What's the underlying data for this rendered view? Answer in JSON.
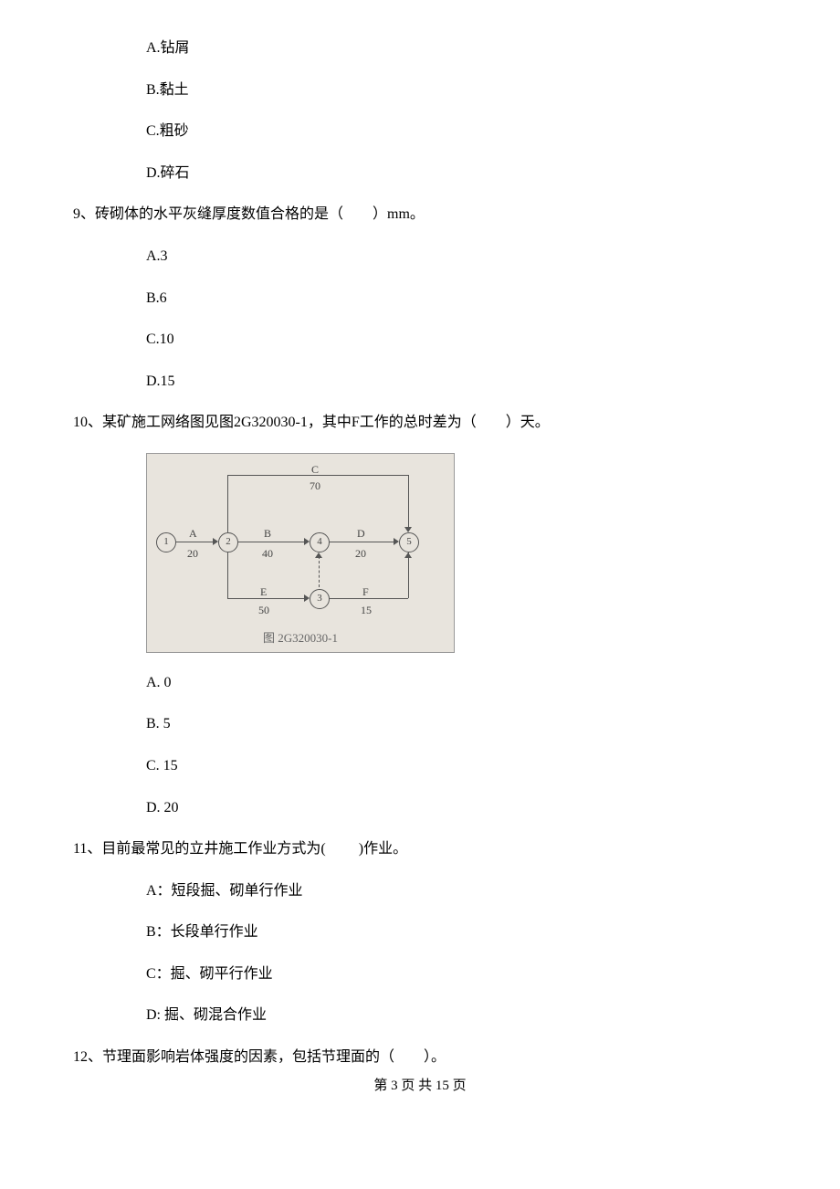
{
  "q8": {
    "options": {
      "A": "A.钻屑",
      "B": "B.黏土",
      "C": "C.粗砂",
      "D": "D.碎石"
    }
  },
  "q9": {
    "text": "9、砖砌体的水平灰缝厚度数值合格的是（　　）mm。",
    "options": {
      "A": "A.3",
      "B": "B.6",
      "C": "C.10",
      "D": "D.15"
    }
  },
  "q10": {
    "text": "10、某矿施工网络图见图2G320030-1，其中F工作的总时差为（　　）天。",
    "options": {
      "A": "A. 0",
      "B": "B. 5",
      "C": "C. 15",
      "D": "D. 20"
    }
  },
  "q11": {
    "text": "11、目前最常见的立井施工作业方式为(　　 )作业。",
    "options": {
      "A": "A：短段掘、砌单行作业",
      "B": "B：长段单行作业",
      "C": "C：掘、砌平行作业",
      "D": "D: 掘、砌混合作业"
    }
  },
  "q12": {
    "text": "12、节理面影响岩体强度的因素，包括节理面的（　　）。"
  },
  "diagram": {
    "caption": "图 2G320030-1",
    "nodes": {
      "n1": "1",
      "n2": "2",
      "n3": "3",
      "n4": "4",
      "n5": "5"
    },
    "edges": {
      "A_label": "A",
      "A_val": "20",
      "B_label": "B",
      "B_val": "40",
      "C_label": "C",
      "C_val": "70",
      "D_label": "D",
      "D_val": "20",
      "E_label": "E",
      "E_val": "50",
      "F_label": "F",
      "F_val": "15"
    }
  },
  "footer": "第 3 页 共 15 页"
}
